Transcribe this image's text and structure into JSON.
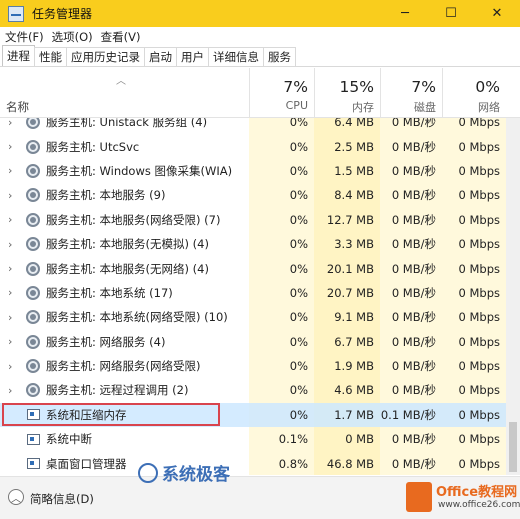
{
  "window": {
    "title": "任务管理器",
    "controls": {
      "minimize": "─",
      "maximize": "☐",
      "close": "✕"
    }
  },
  "menu": [
    "文件(F)",
    "选项(O)",
    "查看(V)"
  ],
  "tabs": [
    "进程",
    "性能",
    "应用历史记录",
    "启动",
    "用户",
    "详细信息",
    "服务"
  ],
  "active_tab": "进程",
  "columns": {
    "name": "名称",
    "cpu": {
      "pct": "7%",
      "label": "CPU"
    },
    "mem": {
      "pct": "15%",
      "label": "内存"
    },
    "disk": {
      "pct": "7%",
      "label": "磁盘"
    },
    "net": {
      "pct": "0%",
      "label": "网络"
    }
  },
  "rows": [
    {
      "name": "服务主机: Unistack 服务组 (4)",
      "cpu": "0%",
      "mem": "6.4 MB",
      "disk": "0 MB/秒",
      "net": "0 Mbps",
      "icon": "gear-icon",
      "expandable": true
    },
    {
      "name": "服务主机: UtcSvc",
      "cpu": "0%",
      "mem": "2.5 MB",
      "disk": "0 MB/秒",
      "net": "0 Mbps",
      "icon": "gear-icon",
      "expandable": true
    },
    {
      "name": "服务主机: Windows 图像采集(WIA)",
      "cpu": "0%",
      "mem": "1.5 MB",
      "disk": "0 MB/秒",
      "net": "0 Mbps",
      "icon": "gear-icon",
      "expandable": true
    },
    {
      "name": "服务主机: 本地服务 (9)",
      "cpu": "0%",
      "mem": "8.4 MB",
      "disk": "0 MB/秒",
      "net": "0 Mbps",
      "icon": "gear-icon",
      "expandable": true
    },
    {
      "name": "服务主机: 本地服务(网络受限) (7)",
      "cpu": "0%",
      "mem": "12.7 MB",
      "disk": "0 MB/秒",
      "net": "0 Mbps",
      "icon": "gear-icon",
      "expandable": true
    },
    {
      "name": "服务主机: 本地服务(无模拟) (4)",
      "cpu": "0%",
      "mem": "3.3 MB",
      "disk": "0 MB/秒",
      "net": "0 Mbps",
      "icon": "gear-icon",
      "expandable": true
    },
    {
      "name": "服务主机: 本地服务(无网络) (4)",
      "cpu": "0%",
      "mem": "20.1 MB",
      "disk": "0 MB/秒",
      "net": "0 Mbps",
      "icon": "gear-icon",
      "expandable": true
    },
    {
      "name": "服务主机: 本地系统 (17)",
      "cpu": "0%",
      "mem": "20.7 MB",
      "disk": "0 MB/秒",
      "net": "0 Mbps",
      "icon": "gear-icon",
      "expandable": true
    },
    {
      "name": "服务主机: 本地系统(网络受限) (10)",
      "cpu": "0%",
      "mem": "9.1 MB",
      "disk": "0 MB/秒",
      "net": "0 Mbps",
      "icon": "gear-icon",
      "expandable": true
    },
    {
      "name": "服务主机: 网络服务 (4)",
      "cpu": "0%",
      "mem": "6.7 MB",
      "disk": "0 MB/秒",
      "net": "0 Mbps",
      "icon": "gear-icon",
      "expandable": true
    },
    {
      "name": "服务主机: 网络服务(网络受限)",
      "cpu": "0%",
      "mem": "1.9 MB",
      "disk": "0 MB/秒",
      "net": "0 Mbps",
      "icon": "gear-icon",
      "expandable": true
    },
    {
      "name": "服务主机: 远程过程调用 (2)",
      "cpu": "0%",
      "mem": "4.6 MB",
      "disk": "0 MB/秒",
      "net": "0 Mbps",
      "icon": "gear-icon",
      "expandable": true
    },
    {
      "name": "系统和压缩内存",
      "cpu": "0%",
      "mem": "1.7 MB",
      "disk": "0.1 MB/秒",
      "net": "0 Mbps",
      "icon": "window-icon",
      "expandable": false,
      "selected": true
    },
    {
      "name": "系统中断",
      "cpu": "0.1%",
      "mem": "0 MB",
      "disk": "0 MB/秒",
      "net": "0 Mbps",
      "icon": "window-icon",
      "expandable": false
    },
    {
      "name": "桌面窗口管理器",
      "cpu": "0.8%",
      "mem": "46.8 MB",
      "disk": "0 MB/秒",
      "net": "0 Mbps",
      "icon": "window-icon",
      "expandable": false
    }
  ],
  "footer": {
    "label": "简略信息(D)"
  },
  "watermarks": {
    "site1": "系统极客",
    "site2": "Office教程网",
    "site2_url": "www.office26.com"
  },
  "colors": {
    "titlebar": "#f9cd1d",
    "cpu_col": "#fff4c4",
    "selection": "#cce8ff",
    "highlight_box": "#d9444d"
  }
}
